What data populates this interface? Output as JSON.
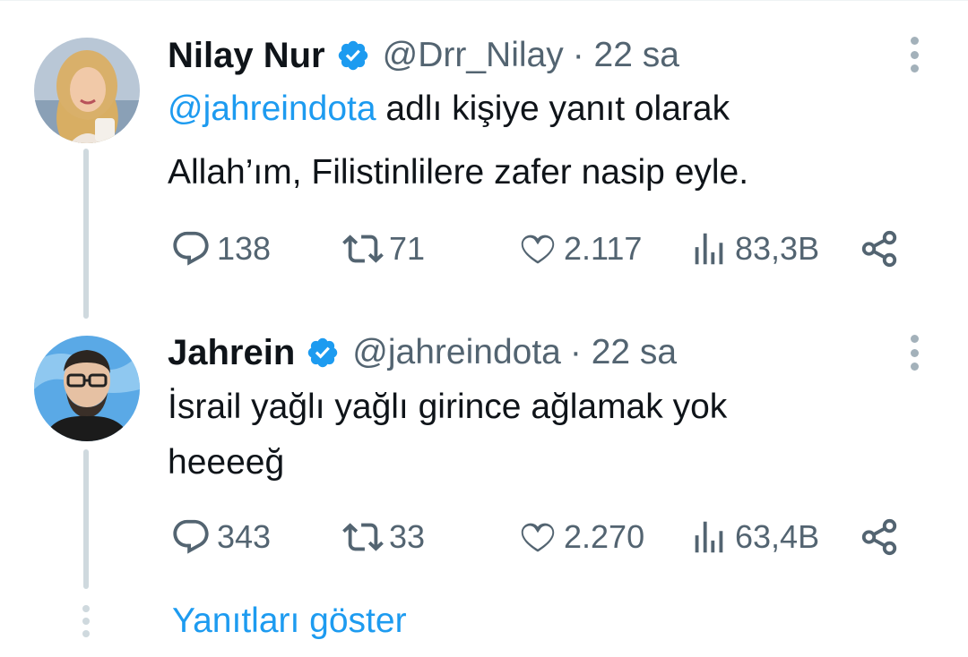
{
  "tweets": [
    {
      "name": "Nilay Nur",
      "handle": "@Drr_Nilay",
      "time": "· 22 sa",
      "reply_mention": "@jahreindota",
      "reply_suffix": " adlı kişiye yanıt olarak",
      "text": "Allah’ım, Filistinlilere zafer nasip eyle.",
      "stats": {
        "replies": "138",
        "retweets": "71",
        "likes": "2.117",
        "views": "83,3B"
      },
      "verified": true
    },
    {
      "name": "Jahrein",
      "handle": "@jahreindota",
      "time": "· 22 sa",
      "text_line1": "İsrail yağlı yağlı girince ağlamak yok",
      "text_line2": "heeeeğ",
      "stats": {
        "replies": "343",
        "retweets": "33",
        "likes": "2.270",
        "views": "63,4B"
      },
      "verified": true
    }
  ],
  "show_replies": "Yanıtları göster",
  "colors": {
    "accent": "#1d9bf0",
    "secondary_text": "#536471",
    "thread_line": "#cfd9de"
  },
  "icons": [
    "reply-icon",
    "retweet-icon",
    "like-icon",
    "views-icon",
    "share-icon",
    "verified-badge-icon",
    "more-icon"
  ]
}
